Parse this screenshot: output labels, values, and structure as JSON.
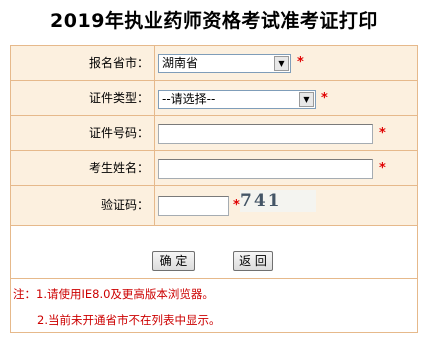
{
  "title": "2019年执业药师资格考试准考证打印",
  "form": {
    "province_label": "报名省市：",
    "province_value": "湖南省",
    "idtype_label": "证件类型：",
    "idtype_value": "--请选择--",
    "idno_label": "证件号码：",
    "idno_value": "",
    "name_label": "考生姓名：",
    "name_value": "",
    "captcha_label": "验证码：",
    "captcha_value": "",
    "captcha_text": "741 71",
    "required_mark": "*"
  },
  "buttons": {
    "confirm": "确 定",
    "back": "返 回"
  },
  "notes": {
    "line1": "注：1.请使用IE8.0及更高版本浏览器。",
    "line2": "2.当前未开通省市不在列表中显示。"
  },
  "colors": {
    "row_bg": "#fcf0df",
    "border": "#e6b98b",
    "required": "#e00000",
    "note_text": "#cc0000"
  }
}
